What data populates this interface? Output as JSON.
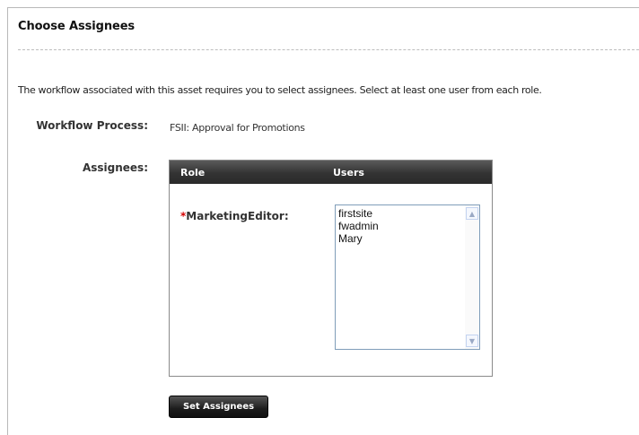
{
  "page": {
    "title": "Choose Assignees",
    "intro": "The workflow associated with this asset requires you to select assignees. Select at least one user from each role."
  },
  "form": {
    "workflow_label": "Workflow Process:",
    "workflow_value": "FSII: Approval for Promotions",
    "assignees_label": "Assignees:"
  },
  "table": {
    "columns": [
      "Role",
      "Users"
    ],
    "rows": [
      {
        "required_marker": "*",
        "role": "MarketingEditor:",
        "users": [
          "firstsite",
          "fwadmin",
          "Mary"
        ]
      }
    ]
  },
  "actions": {
    "set_assignees_label": "Set Assignees"
  }
}
